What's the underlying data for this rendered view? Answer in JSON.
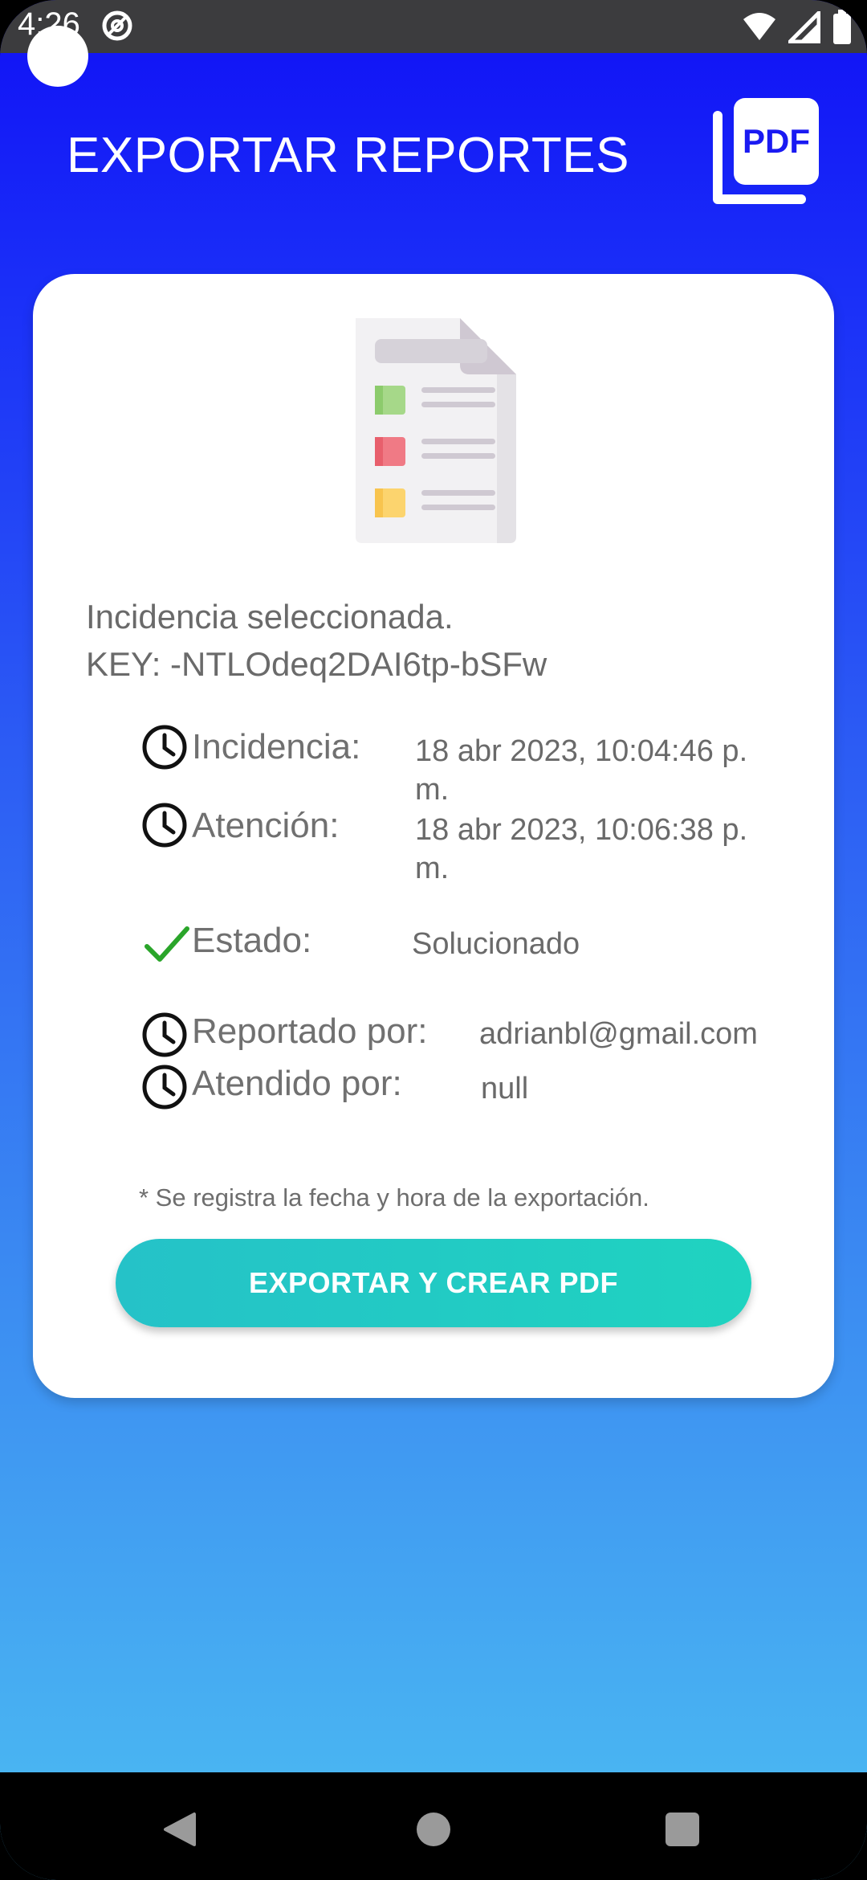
{
  "status_bar": {
    "time": "4:26",
    "icons": [
      "at-sign-icon",
      "wifi-icon",
      "signal-icon",
      "battery-icon"
    ]
  },
  "header": {
    "title": "EXPORTAR REPORTES",
    "pdf_icon_text": "PDF"
  },
  "card": {
    "selected_text": "Incidencia seleccionada.",
    "key_text": "KEY: -NTLOdeq2DAI6tp-bSFw",
    "rows": [
      {
        "icon": "clock-icon",
        "label": "Incidencia:",
        "value": "18 abr 2023, 10:04:46 p. m."
      },
      {
        "icon": "clock-icon",
        "label": "Atención:",
        "value": "18 abr 2023, 10:06:38 p. m."
      },
      {
        "icon": "check-icon",
        "label": "Estado:",
        "value": "Solucionado"
      },
      {
        "icon": "clock-icon",
        "label": "Reportado por:",
        "value": "adrianbl@gmail.com"
      },
      {
        "icon": "clock-icon",
        "label": "Atendido por:",
        "value": "null"
      }
    ],
    "note": "* Se registra la fecha y hora de la exportación.",
    "export_button_label": "EXPORTAR Y CREAR PDF"
  },
  "colors": {
    "header_gradient_top": "#1010f6",
    "header_gradient_bottom": "#4cbdf2",
    "button_teal": "#1fd3c0",
    "check_green": "#2aa52a"
  },
  "nav_bar": {
    "icons": [
      "back-icon",
      "home-icon",
      "recents-icon"
    ]
  }
}
